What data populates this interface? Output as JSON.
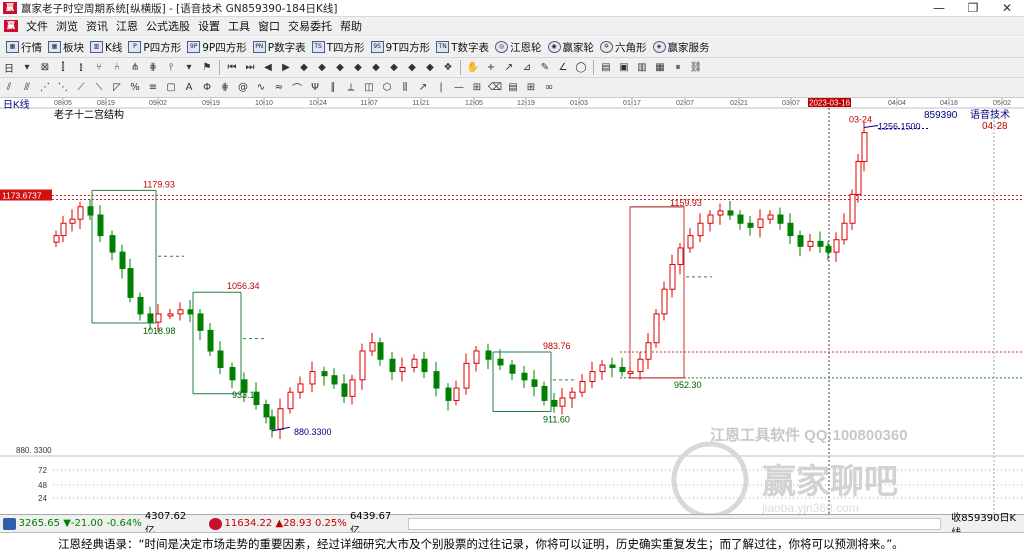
{
  "window": {
    "title": "赢家老子时空周期系统[纵横版] - [语音技术  GN859390-184日K线]",
    "logo_text": "赢",
    "controls": [
      "—",
      "❐",
      "✕"
    ]
  },
  "menu": {
    "logo_text": "赢",
    "items": [
      "文件",
      "浏览",
      "资讯",
      "江恩",
      "公式选股",
      "设置",
      "工具",
      "窗口",
      "交易委托",
      "帮助"
    ],
    "mdi": [
      "_",
      "▫",
      "x"
    ]
  },
  "toolbar1": {
    "items": [
      {
        "label": "行情",
        "icon": "grid-icon"
      },
      {
        "label": "板块",
        "icon": "blocks-icon"
      },
      {
        "label": "K线",
        "icon": "kline-icon"
      },
      {
        "label": "P四方形",
        "icon": "square-p-icon"
      },
      {
        "label": "9P四方形",
        "icon": "square-9p-icon"
      },
      {
        "label": "P数字表",
        "icon": "table-p-icon"
      },
      {
        "label": "T四方形",
        "icon": "square-t-icon"
      },
      {
        "label": "9T四方形",
        "icon": "square-9t-icon"
      },
      {
        "label": "T数字表",
        "icon": "table-t-icon"
      },
      {
        "label": "江恩轮",
        "icon": "wheel-icon"
      },
      {
        "label": "赢家轮",
        "icon": "winwheel-icon"
      },
      {
        "label": "六角形",
        "icon": "hexagon-icon"
      },
      {
        "label": "赢家服务",
        "icon": "service-icon"
      }
    ]
  },
  "chart": {
    "panel_label": "日K线",
    "indicator_title": "老子十二宫结构",
    "top_right_code": "859390",
    "top_right_name": "语音技术",
    "top_right_date": "04-28",
    "cursor_date": "2023-03-16",
    "date_ticks": [
      "08-05",
      "08-19",
      "09-02",
      "09-19",
      "10-10",
      "10-24",
      "11-07",
      "11-21",
      "12-05",
      "12-19",
      "01-03",
      "01-17",
      "02-07",
      "02-21",
      "03-07",
      "04-04",
      "04-18",
      "05-02"
    ],
    "price_label_left": "1173.6737",
    "min_label_left": "880. 3300",
    "volume_ticks": [
      "72",
      "48",
      "24"
    ],
    "box_labels": [
      {
        "text": "1179.93",
        "color": "#c00000"
      },
      {
        "text": "1018.98",
        "color": "#006000"
      },
      {
        "text": "1056.34",
        "color": "#c00000"
      },
      {
        "text": "933.1",
        "color": "#006000"
      },
      {
        "text": "880.3300",
        "color": "#000080"
      },
      {
        "text": "983.76",
        "color": "#c00000"
      },
      {
        "text": "911.60",
        "color": "#006000"
      },
      {
        "text": "1159.93",
        "color": "#c00000"
      },
      {
        "text": "952.30",
        "color": "#006000"
      },
      {
        "text": "1256.1500",
        "color": "#000080"
      },
      {
        "text": "03-24",
        "color": "#c00000"
      }
    ],
    "watermark_line1": "江恩工具软件  QQ:100800360",
    "watermark_line2": "赢家聊吧",
    "watermark_line3": "jiaoba.yjn360.com"
  },
  "chart_data": {
    "type": "candlestick",
    "title": "老子十二宫结构",
    "xlabel": "",
    "ylabel": "",
    "ylim": [
      860,
      1275
    ],
    "x": [
      "08-05",
      "08-19",
      "09-02",
      "09-19",
      "10-10",
      "10-24",
      "11-07",
      "11-21",
      "12-05",
      "12-19",
      "01-03",
      "01-17",
      "02-07",
      "02-21",
      "03-07",
      "03-16",
      "03-24"
    ],
    "series": [
      {
        "values": [
          1130,
          1165,
          1055,
          1030,
          995,
          918,
          945,
          990,
          945,
          968,
          940,
          948,
          1125,
          1152,
          1140,
          1120,
          1256
        ]
      }
    ],
    "reference_lines": [
      1173.6737,
      1159.93,
      983.76,
      952.3
    ],
    "colors": {
      "up": "#e00000",
      "down": "#008000",
      "box_upper": "#e00000",
      "box_lower": "#008000",
      "pointer": "#000080"
    }
  },
  "statusbar": {
    "index1_value": "3265.65",
    "index1_change": "▼-21.00",
    "index1_pct": "-0.64%",
    "index1_amount": "4307.62亿",
    "index2_value": "11634.22",
    "index2_change": "▲28.93",
    "index2_pct": "0.25%",
    "index2_amount": "6439.67亿",
    "right_text": "收859390日K线"
  },
  "ticker": {
    "text": "江恩经典语录：“时间是决定市场走势的重要因素，经过详细研究大市及个别股票的过往记录，你将可以证明，历史确实重复发生；而了解过往，你将可以预测将来。”。"
  }
}
